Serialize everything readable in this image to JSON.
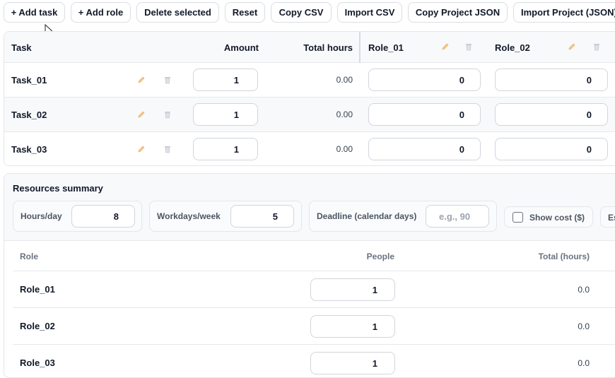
{
  "toolbar": {
    "add_task": "+ Add task",
    "add_role": "+ Add role",
    "delete_selected": "Delete selected",
    "reset": "Reset",
    "copy_csv": "Copy CSV",
    "import_csv": "Import CSV",
    "copy_project_json": "Copy Project JSON",
    "import_project_json": "Import Project (JSON)"
  },
  "task_table": {
    "headers": {
      "task": "Task",
      "amount": "Amount",
      "total_hours": "Total hours",
      "role_01": "Role_01",
      "role_02": "Role_02"
    },
    "rows": [
      {
        "name": "Task_01",
        "amount": "1",
        "total_hours": "0.00",
        "role_01": "0",
        "role_02": "0"
      },
      {
        "name": "Task_02",
        "amount": "1",
        "total_hours": "0.00",
        "role_01": "0",
        "role_02": "0"
      },
      {
        "name": "Task_03",
        "amount": "1",
        "total_hours": "0.00",
        "role_01": "0",
        "role_02": "0"
      }
    ]
  },
  "summary": {
    "title": "Resources summary",
    "hours_per_day_label": "Hours/day",
    "hours_per_day": "8",
    "workdays_label": "Workdays/week",
    "workdays": "5",
    "deadline_label": "Deadline (calendar days)",
    "deadline_placeholder": "e.g., 90",
    "show_cost_label": "Show cost ($)",
    "cut_label": "Es",
    "headers": {
      "role": "Role",
      "people": "People",
      "total_hours": "Total (hours)"
    },
    "rows": [
      {
        "role": "Role_01",
        "people": "1",
        "total": "0.0"
      },
      {
        "role": "Role_02",
        "people": "1",
        "total": "0.0"
      },
      {
        "role": "Role_03",
        "people": "1",
        "total": "0.0"
      }
    ]
  },
  "colors": {
    "accent_pencil": "#f0b46a",
    "trash": "#c5cad2",
    "border": "#e3e6ea"
  },
  "icons": {
    "edit": "pencil-icon",
    "delete": "trash-icon",
    "cursor": "mouse-pointer-icon"
  }
}
